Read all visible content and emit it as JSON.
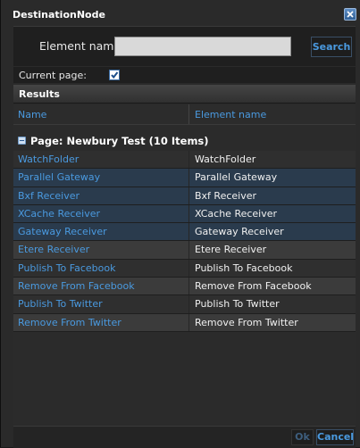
{
  "dialog": {
    "title": "DestinationNode",
    "close_icon": "close-icon"
  },
  "search": {
    "label": "Element name:",
    "value": "",
    "placeholder": "",
    "button_label": "Search"
  },
  "current_page": {
    "label": "Current page:",
    "checked": true
  },
  "results": {
    "title": "Results",
    "columns": [
      "Name",
      "Element name"
    ],
    "group_label": "Page: Newbury Test (10 Items)",
    "rows": [
      {
        "name": "WatchFolder",
        "element": "WatchFolder"
      },
      {
        "name": "Parallel Gateway",
        "element": "Parallel Gateway"
      },
      {
        "name": "Bxf Receiver",
        "element": "Bxf Receiver"
      },
      {
        "name": "XCache Receiver",
        "element": "XCache Receiver"
      },
      {
        "name": "Gateway Receiver",
        "element": "Gateway Receiver"
      },
      {
        "name": "Etere Receiver",
        "element": "Etere Receiver"
      },
      {
        "name": "Publish To Facebook",
        "element": "Publish To Facebook"
      },
      {
        "name": "Remove From Facebook",
        "element": "Remove From Facebook"
      },
      {
        "name": "Publish To Twitter",
        "element": "Publish To Twitter"
      },
      {
        "name": "Remove From Twitter",
        "element": "Remove From Twitter"
      }
    ]
  },
  "footer": {
    "ok_label": "Ok",
    "cancel_label": "Cancel"
  },
  "colors": {
    "accent": "#4a9ae0",
    "background": "#2a2a2a"
  }
}
